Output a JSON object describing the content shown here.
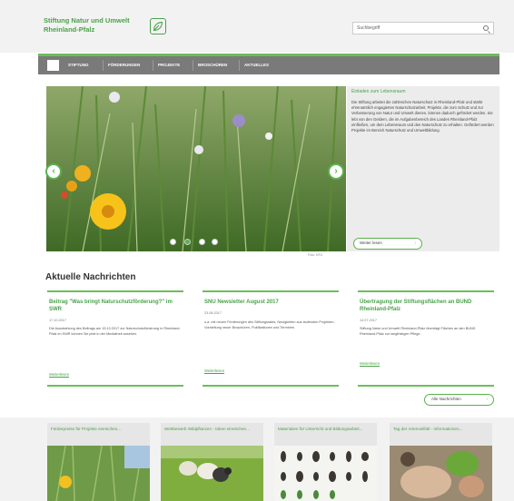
{
  "header": {
    "logo_line1": "Stiftung Natur und Umwelt",
    "logo_line2": "Rheinland-Pfalz",
    "search_placeholder": "Suchbegriff"
  },
  "nav": {
    "items": [
      "Stiftung",
      "Förderungen",
      "Projekte",
      "Broschüren",
      "Aktuelles"
    ]
  },
  "hero": {
    "side_title": "Einladen zum Lebensraum",
    "side_text": "Die Stiftung arbeitet die zahlreichen Naturschutz in Rheinland-Pfalz und stärkt ehrenamtlich engagierten Naturschutzarbeit. Projekte, die zum Schutz und zur Verbesserung von Natur und Umwelt dienen, können dadurch gefördert werden. Sie lebt von den Geldern, die im Aufgabenbereich des Landes Rheinland-Pfalz einfließen, um dem Lebensraum und den Naturschutz zu erhalten. Gefördert werden Projekte im Bereich Naturschutz und Umweltbildung.",
    "side_button": "Weiter lesen",
    "credit": "Foto: NTU"
  },
  "news": {
    "section_title": "Aktuelle Nachrichten",
    "cards": [
      {
        "headline": "Beitrag \"Was bringt Naturschutzförderung?\" im SWR",
        "date": "17.10.2017",
        "body": "Die Ausstrahlung des Beitrags am 15.10.2017 zur Naturschutzförderung in Rheinland-Pfalz im SWR können Sie jetzt in der Mediathek ansehen.",
        "more": "Weiterlesen"
      },
      {
        "headline": "SNU Newsletter August 2017",
        "date": "23.08.2017",
        "body": "u.a. mit neuen Förderungen des Stiftungsrates, Neuigkeiten aus laufenden Projekten, Vorstellung neuer Broschüren, Publikationen und Terminen.",
        "more": "Weiterlesen"
      },
      {
        "headline": "Übertragung der Stiftungsflächen an BUND Rheinland-Pfalz",
        "date": "14.07.2017",
        "body": "Stiftung Natur und Umwelt Rheinland-Pfalz überträgt Flächen an den BUND Rheinland-Pfalz zur langfristigen Pflege.",
        "more": "Weiterlesen"
      }
    ],
    "all_button": "Alle Nachrichten"
  },
  "tiles": [
    {
      "title": "Förderpreise für Projekte einreichen..."
    },
    {
      "title": "Wettbewerb Wildpflanzen - Ideen einreichen..."
    },
    {
      "title": "Materialien für Unterricht und Bildungsarbeit..."
    },
    {
      "title": "Tag der Artenvielfalt - Informationen..."
    }
  ],
  "colors": {
    "accent": "#4aa24a",
    "nav_bg": "#7a7a7a",
    "page_bg": "#f2f2f2"
  },
  "hero_slider": {
    "slide_count": 3,
    "active_slide": 1
  }
}
